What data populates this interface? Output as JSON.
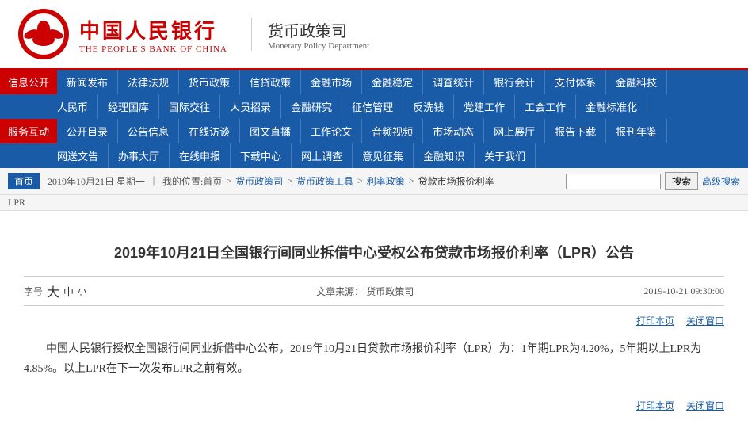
{
  "header": {
    "logo_cn": "中国人民银行",
    "logo_en": "THE PEOPLE'S BANK OF CHINA",
    "dept_cn": "货币政策司",
    "dept_en": "Monetary Policy Department"
  },
  "nav": {
    "row1_label": "信息公开",
    "row1_items": [
      "新闻发布",
      "法律法规",
      "货币政策",
      "信贷政策",
      "金融市场",
      "金融稳定",
      "调查统计",
      "银行会计",
      "支付体系",
      "金融科技"
    ],
    "row2_label": "",
    "row2_items": [
      "人民币",
      "经理国库",
      "国际交往",
      "人员招录",
      "金融研究",
      "征信管理",
      "反洗钱",
      "党建工作",
      "工会工作",
      "金融标准化"
    ],
    "row3_label": "服务互动",
    "row3_items": [
      "公开目录",
      "公告信息",
      "在线访谈",
      "图文直播",
      "工作论文",
      "音频视频",
      "市场动态",
      "网上展厅",
      "报告下载",
      "报刊年鉴"
    ],
    "row4_label": "",
    "row4_items": [
      "网送文告",
      "办事大厅",
      "在线申报",
      "下载中心",
      "网上调查",
      "意见征集",
      "金融知识",
      "关于我们"
    ]
  },
  "breadcrumb": {
    "home": "首页",
    "date": "2019年10月21日 星期一",
    "location_label": "我的位置:首页",
    "path": [
      "货币政策司",
      "货币政策工具",
      "利率政策",
      "贷款市场报价利率"
    ],
    "sub_label": "LPR",
    "search_placeholder": "",
    "search_btn": "搜索",
    "advanced": "高级搜索"
  },
  "article": {
    "title": "2019年10月21日全国银行间同业拆借中心受权公布贷款市场报价利率（LPR）公告",
    "font_label": "字号",
    "font_big": "大",
    "font_mid": "中",
    "font_small": "小",
    "source_label": "文章来源：",
    "source": "货币政策司",
    "date": "2019-10-21 09:30:00",
    "print": "打印本页",
    "close": "关闭窗口",
    "body": "中国人民银行授权全国银行间同业拆借中心公布，2019年10月21日贷款市场报价利率（LPR）为：1年期LPR为4.20%，5年期以上LPR为4.85%。以上LPR在下一次发布LPR之前有效。"
  }
}
